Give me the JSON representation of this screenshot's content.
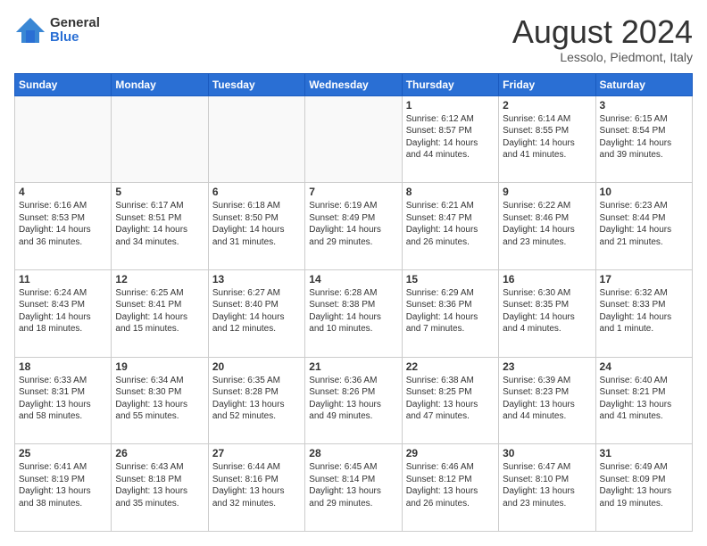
{
  "logo": {
    "general": "General",
    "blue": "Blue"
  },
  "header": {
    "month": "August 2024",
    "location": "Lessolo, Piedmont, Italy"
  },
  "days_of_week": [
    "Sunday",
    "Monday",
    "Tuesday",
    "Wednesday",
    "Thursday",
    "Friday",
    "Saturday"
  ],
  "weeks": [
    [
      {
        "day": "",
        "info": ""
      },
      {
        "day": "",
        "info": ""
      },
      {
        "day": "",
        "info": ""
      },
      {
        "day": "",
        "info": ""
      },
      {
        "day": "1",
        "info": "Sunrise: 6:12 AM\nSunset: 8:57 PM\nDaylight: 14 hours and 44 minutes."
      },
      {
        "day": "2",
        "info": "Sunrise: 6:14 AM\nSunset: 8:55 PM\nDaylight: 14 hours and 41 minutes."
      },
      {
        "day": "3",
        "info": "Sunrise: 6:15 AM\nSunset: 8:54 PM\nDaylight: 14 hours and 39 minutes."
      }
    ],
    [
      {
        "day": "4",
        "info": "Sunrise: 6:16 AM\nSunset: 8:53 PM\nDaylight: 14 hours and 36 minutes."
      },
      {
        "day": "5",
        "info": "Sunrise: 6:17 AM\nSunset: 8:51 PM\nDaylight: 14 hours and 34 minutes."
      },
      {
        "day": "6",
        "info": "Sunrise: 6:18 AM\nSunset: 8:50 PM\nDaylight: 14 hours and 31 minutes."
      },
      {
        "day": "7",
        "info": "Sunrise: 6:19 AM\nSunset: 8:49 PM\nDaylight: 14 hours and 29 minutes."
      },
      {
        "day": "8",
        "info": "Sunrise: 6:21 AM\nSunset: 8:47 PM\nDaylight: 14 hours and 26 minutes."
      },
      {
        "day": "9",
        "info": "Sunrise: 6:22 AM\nSunset: 8:46 PM\nDaylight: 14 hours and 23 minutes."
      },
      {
        "day": "10",
        "info": "Sunrise: 6:23 AM\nSunset: 8:44 PM\nDaylight: 14 hours and 21 minutes."
      }
    ],
    [
      {
        "day": "11",
        "info": "Sunrise: 6:24 AM\nSunset: 8:43 PM\nDaylight: 14 hours and 18 minutes."
      },
      {
        "day": "12",
        "info": "Sunrise: 6:25 AM\nSunset: 8:41 PM\nDaylight: 14 hours and 15 minutes."
      },
      {
        "day": "13",
        "info": "Sunrise: 6:27 AM\nSunset: 8:40 PM\nDaylight: 14 hours and 12 minutes."
      },
      {
        "day": "14",
        "info": "Sunrise: 6:28 AM\nSunset: 8:38 PM\nDaylight: 14 hours and 10 minutes."
      },
      {
        "day": "15",
        "info": "Sunrise: 6:29 AM\nSunset: 8:36 PM\nDaylight: 14 hours and 7 minutes."
      },
      {
        "day": "16",
        "info": "Sunrise: 6:30 AM\nSunset: 8:35 PM\nDaylight: 14 hours and 4 minutes."
      },
      {
        "day": "17",
        "info": "Sunrise: 6:32 AM\nSunset: 8:33 PM\nDaylight: 14 hours and 1 minute."
      }
    ],
    [
      {
        "day": "18",
        "info": "Sunrise: 6:33 AM\nSunset: 8:31 PM\nDaylight: 13 hours and 58 minutes."
      },
      {
        "day": "19",
        "info": "Sunrise: 6:34 AM\nSunset: 8:30 PM\nDaylight: 13 hours and 55 minutes."
      },
      {
        "day": "20",
        "info": "Sunrise: 6:35 AM\nSunset: 8:28 PM\nDaylight: 13 hours and 52 minutes."
      },
      {
        "day": "21",
        "info": "Sunrise: 6:36 AM\nSunset: 8:26 PM\nDaylight: 13 hours and 49 minutes."
      },
      {
        "day": "22",
        "info": "Sunrise: 6:38 AM\nSunset: 8:25 PM\nDaylight: 13 hours and 47 minutes."
      },
      {
        "day": "23",
        "info": "Sunrise: 6:39 AM\nSunset: 8:23 PM\nDaylight: 13 hours and 44 minutes."
      },
      {
        "day": "24",
        "info": "Sunrise: 6:40 AM\nSunset: 8:21 PM\nDaylight: 13 hours and 41 minutes."
      }
    ],
    [
      {
        "day": "25",
        "info": "Sunrise: 6:41 AM\nSunset: 8:19 PM\nDaylight: 13 hours and 38 minutes."
      },
      {
        "day": "26",
        "info": "Sunrise: 6:43 AM\nSunset: 8:18 PM\nDaylight: 13 hours and 35 minutes."
      },
      {
        "day": "27",
        "info": "Sunrise: 6:44 AM\nSunset: 8:16 PM\nDaylight: 13 hours and 32 minutes."
      },
      {
        "day": "28",
        "info": "Sunrise: 6:45 AM\nSunset: 8:14 PM\nDaylight: 13 hours and 29 minutes."
      },
      {
        "day": "29",
        "info": "Sunrise: 6:46 AM\nSunset: 8:12 PM\nDaylight: 13 hours and 26 minutes."
      },
      {
        "day": "30",
        "info": "Sunrise: 6:47 AM\nSunset: 8:10 PM\nDaylight: 13 hours and 23 minutes."
      },
      {
        "day": "31",
        "info": "Sunrise: 6:49 AM\nSunset: 8:09 PM\nDaylight: 13 hours and 19 minutes."
      }
    ]
  ]
}
